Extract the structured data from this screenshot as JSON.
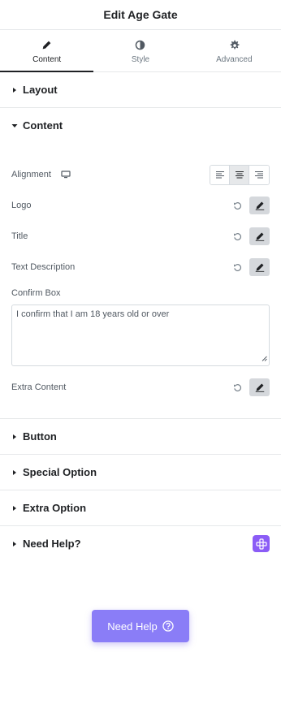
{
  "header": {
    "title": "Edit Age Gate"
  },
  "tabs": [
    {
      "label": "Content",
      "icon": "pencil-icon",
      "active": true
    },
    {
      "label": "Style",
      "icon": "contrast-icon",
      "active": false
    },
    {
      "label": "Advanced",
      "icon": "gear-icon",
      "active": false
    }
  ],
  "sections": {
    "layout": {
      "title": "Layout",
      "expanded": false
    },
    "content": {
      "title": "Content",
      "expanded": true,
      "alignment": {
        "label": "Alignment",
        "selected": "center",
        "options": [
          "left",
          "center",
          "right"
        ]
      },
      "logo": {
        "label": "Logo"
      },
      "title_field": {
        "label": "Title"
      },
      "text_description": {
        "label": "Text Description"
      },
      "confirm_box": {
        "label": "Confirm Box",
        "value": "I confirm that I am 18 years old or over"
      },
      "extra_content": {
        "label": "Extra Content"
      }
    },
    "button": {
      "title": "Button",
      "expanded": false
    },
    "special_option": {
      "title": "Special Option",
      "expanded": false
    },
    "extra_option": {
      "title": "Extra Option",
      "expanded": false
    },
    "need_help": {
      "title": "Need Help?",
      "expanded": false
    }
  },
  "floating_help": {
    "label": "Need Help"
  },
  "colors": {
    "accent": "#8a7df7",
    "badge": "#8b5cf6",
    "text": "#1f2124",
    "muted": "#6d7882",
    "border": "#e6e8ea"
  }
}
